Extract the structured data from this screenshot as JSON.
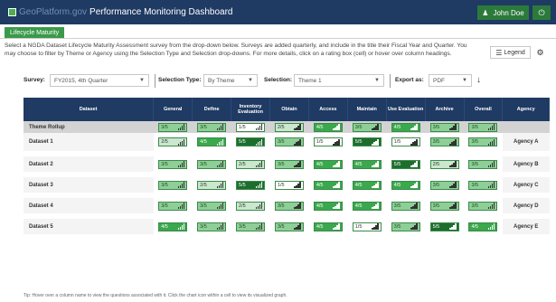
{
  "header": {
    "brand_geo": "GeoPlatform.gov",
    "title": "Performance Monitoring Dashboard",
    "user_name": "John Doe",
    "user_icon": "user-icon",
    "power_icon": "power-icon"
  },
  "tabs": [
    {
      "label": "Lifecycle Maturity",
      "active": true
    }
  ],
  "intro": "Select a NGDA Dataset Lifecycle Maturity Assessment survey from the drop-down below. Surveys are added quarterly, and include in the title their Fiscal Year and Quarter. You may choose to filter by Theme or Agency using the Selection Type and Selection drop-downs. For more details, click on a rating box (cell) or hover over column headings.",
  "toolbar": {
    "legend_label": "Legend",
    "legend_icon": "list-icon",
    "settings_icon": "gear-icon"
  },
  "filters": {
    "survey_label": "Survey:",
    "survey_value": "FY2015, 4th Quarter",
    "selection_type_label": "Selection Type:",
    "selection_type_value": "By Theme",
    "selection_label": "Selection:",
    "selection_value": "Theme 1",
    "export_label": "Export as:",
    "export_value": "PDF",
    "download_icon": "download-icon"
  },
  "table": {
    "headers": [
      "Dataset",
      "General",
      "Define",
      "Inventory Evaluation",
      "Obtain",
      "Access",
      "Maintain",
      "Use Evaluation",
      "Archive",
      "Overall",
      "Agency"
    ],
    "rollup": {
      "label": "Theme Rollup",
      "scores": [
        "3/5",
        "3/5",
        "1/5",
        "2/5",
        "4/5",
        "3/5",
        "4/5",
        "3/5",
        "3/5"
      ],
      "agency": ""
    },
    "rows": [
      {
        "name": "Dataset 1",
        "scores": [
          "2/5",
          "4/5",
          "5/5",
          "3/5",
          "1/5",
          "5/5",
          "1/5",
          "3/5",
          "3/5"
        ],
        "agency": "Agency A"
      },
      {
        "name": "Dataset 2",
        "scores": [
          "3/5",
          "3/5",
          "2/5",
          "3/5",
          "4/5",
          "4/5",
          "5/5",
          "2/5",
          "3/5"
        ],
        "agency": "Agency B"
      },
      {
        "name": "Dataset 3",
        "scores": [
          "3/5",
          "2/5",
          "5/5",
          "1/5",
          "4/5",
          "4/5",
          "4/5",
          "3/5",
          "3/5"
        ],
        "agency": "Agency C"
      },
      {
        "name": "Dataset 4",
        "scores": [
          "3/5",
          "3/5",
          "2/5",
          "3/5",
          "4/5",
          "4/5",
          "3/5",
          "3/5",
          "3/5"
        ],
        "agency": "Agency D"
      },
      {
        "name": "Dataset 5",
        "scores": [
          "4/5",
          "3/5",
          "3/5",
          "3/5",
          "4/5",
          "1/5",
          "3/5",
          "5/5",
          "4/5"
        ],
        "agency": "Agency E"
      }
    ]
  },
  "tip": "Tip: Hover over a column name to view the questions associated with it. Click the chart icon within a cell to view its visualized graph.",
  "colors": {
    "header_bg": "#1f3a63",
    "accent_green": "#2b7a3b",
    "level_1": "#ffffff",
    "level_2": "#c9e8cd",
    "level_3": "#8ecf97",
    "level_4": "#3aa84c",
    "level_5": "#1d6e2d"
  }
}
